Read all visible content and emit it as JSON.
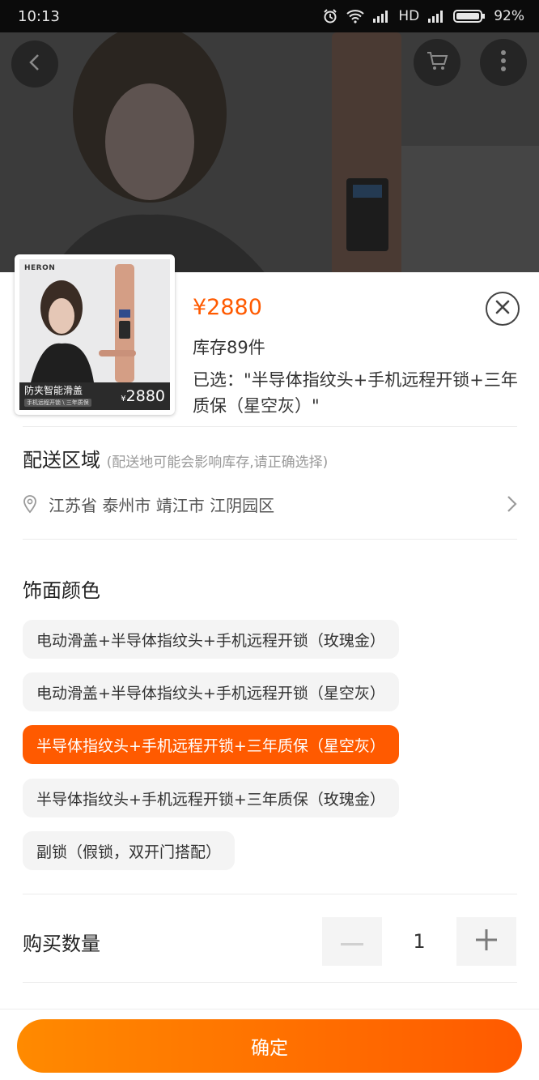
{
  "status_bar": {
    "time": "10:13",
    "network_label": "HD",
    "battery": "92%",
    "icons": [
      "alarm-icon",
      "wifi-icon",
      "signal-icon",
      "signal-icon",
      "battery-icon"
    ]
  },
  "backdrop": {
    "buttons": [
      "back-icon",
      "cart-icon",
      "more-icon"
    ]
  },
  "product": {
    "thumbnail": {
      "brand": "HERON",
      "headline": "防夹智能滑盖",
      "sub": "手机远程开锁 \\ 三年质保",
      "price_symbol": "¥",
      "price": "2880"
    },
    "price": "¥2880",
    "stock": "库存89件",
    "selected": "已选：\"半导体指纹头+手机远程开锁+三年质保（星空灰）\""
  },
  "delivery": {
    "title": "配送区域",
    "hint": "(配送地可能会影响库存,请正确选择)",
    "address": "江苏省 泰州市 靖江市 江阴园区"
  },
  "color": {
    "title": "饰面颜色",
    "options": [
      "电动滑盖+半导体指纹头+手机远程开锁（玫瑰金）",
      "电动滑盖+半导体指纹头+手机远程开锁（星空灰）",
      "半导体指纹头+手机远程开锁+三年质保（星空灰）",
      "半导体指纹头+手机远程开锁+三年质保（玫瑰金）",
      "副锁（假锁，双开门搭配）"
    ],
    "selected_index": 2
  },
  "quantity": {
    "label": "购买数量",
    "value": "1"
  },
  "confirm_label": "确定",
  "colors": {
    "accent": "#ff5a00",
    "accent_light": "#ff8a00",
    "option_bg": "#f4f4f4"
  }
}
